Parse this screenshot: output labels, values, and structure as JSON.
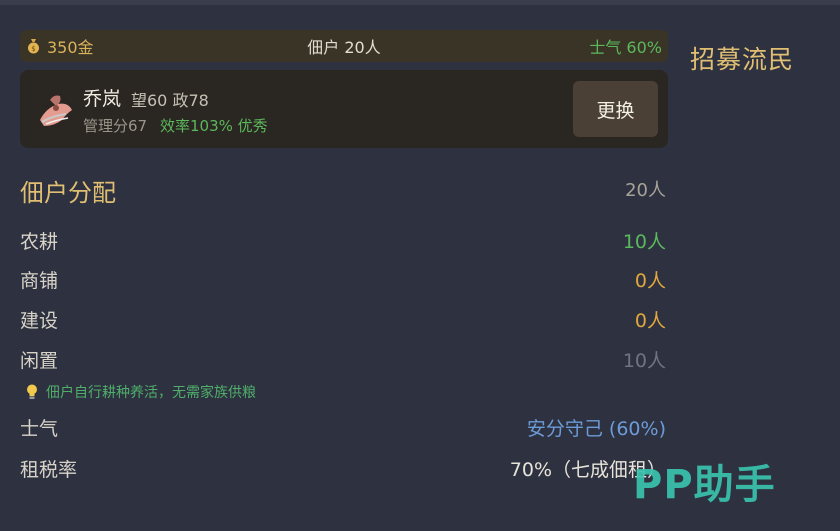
{
  "resources": {
    "gold": "350金",
    "tenants": "佃户 20人",
    "morale": "士气 60%"
  },
  "side_panel": {
    "recruit_label": "招募流民"
  },
  "manager": {
    "name": "乔岚",
    "stats": "望60 政78",
    "score": "管理分67",
    "efficiency": "效率103% 优秀",
    "swap_label": "更换"
  },
  "allocation": {
    "title": "佃户分配",
    "total": "20人",
    "rows": [
      {
        "label": "农耕",
        "value": "10人",
        "color": "#5cb85c"
      },
      {
        "label": "商铺",
        "value": "0人",
        "color": "#e0a83c"
      },
      {
        "label": "建设",
        "value": "0人",
        "color": "#e0a83c"
      },
      {
        "label": "闲置",
        "value": "10人",
        "color": "#6f7480"
      }
    ],
    "tip": "佃户自行耕种养活，无需家族供粮"
  },
  "status": {
    "morale_label": "士气",
    "morale_value": "安分守己 (60%)",
    "tax_label": "租税率",
    "tax_value": "70%（七成佃租）"
  },
  "watermark": "PP助手",
  "icons": {
    "coin": "money-bag-icon",
    "portrait": "character-portrait",
    "tip": "lightbulb-icon"
  }
}
